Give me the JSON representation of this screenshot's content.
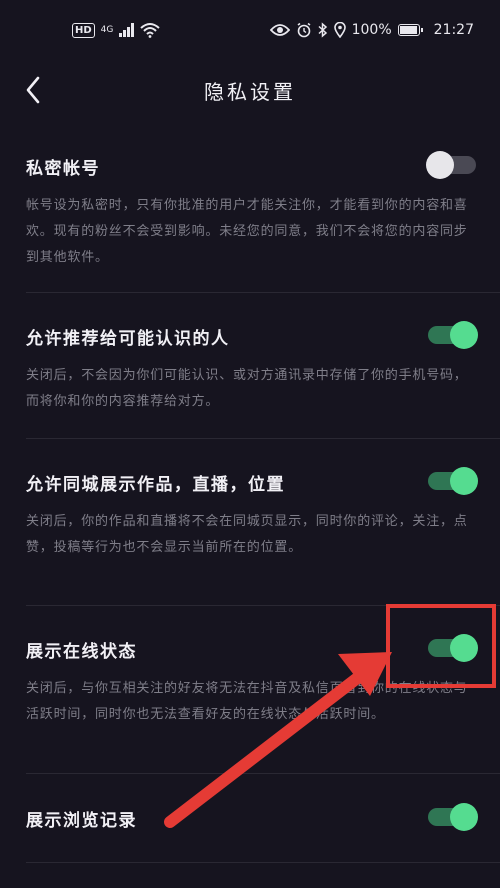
{
  "status_bar": {
    "hd": "HD",
    "network": "4G",
    "battery_percent": "100%",
    "time": "21:27",
    "battery_level": 1.0
  },
  "header": {
    "title": "隐私设置",
    "back_icon": "chevron-left-icon"
  },
  "settings": [
    {
      "title": "私密帐号",
      "description": "帐号设为私密时，只有你批准的用户才能关注你，才能看到你的内容和喜欢。现有的粉丝不会受到影响。未经您的同意，我们不会将您的内容同步到其他软件。",
      "enabled": false
    },
    {
      "title": "允许推荐给可能认识的人",
      "description": "关闭后，不会因为你们可能认识、或对方通讯录中存储了你的手机号码，而将你和你的内容推荐给对方。",
      "enabled": true
    },
    {
      "title": "允许同城展示作品，直播，位置",
      "description": "关闭后，你的作品和直播将不会在同城页显示，同时你的评论，关注，点赞，投稿等行为也不会显示当前所在的位置。",
      "enabled": true
    },
    {
      "title": "展示在线状态",
      "description": "关闭后，与你互相关注的好友将无法在抖音及私信页看到你的在线状态与活跃时间，同时你也无法查看好友的在线状态与活跃时间。",
      "enabled": true
    },
    {
      "title": "展示浏览记录",
      "enabled": true
    }
  ],
  "colors": {
    "background": "#16141f",
    "toggle_on_track": "#2f7654",
    "toggle_on_knob": "#55dc90",
    "toggle_off_track": "#4a4954",
    "toggle_off_knob": "#e7e6ea",
    "annotation_red": "#e53b35"
  }
}
